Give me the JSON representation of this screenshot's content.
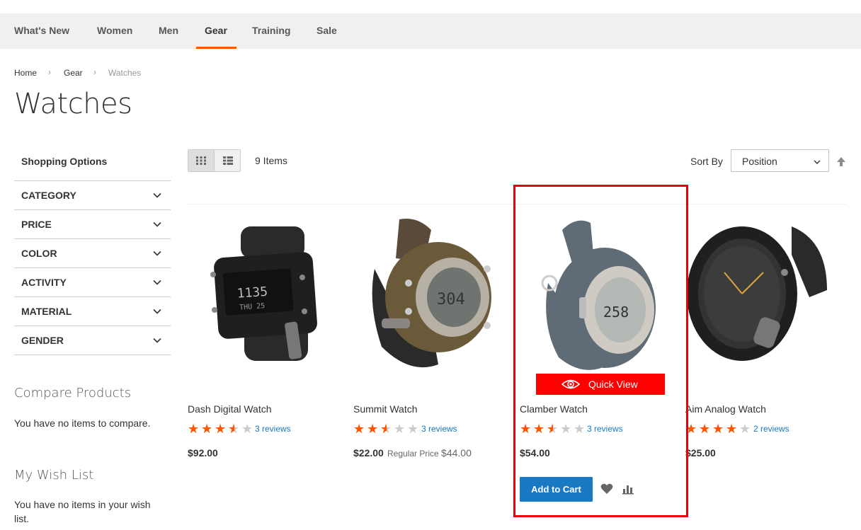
{
  "nav": {
    "items": [
      "What's New",
      "Women",
      "Men",
      "Gear",
      "Training",
      "Sale"
    ],
    "active": "Gear"
  },
  "breadcrumb": [
    "Home",
    "Gear",
    "Watches"
  ],
  "page_title": "Watches",
  "sidebar": {
    "title": "Shopping Options",
    "filters": [
      "CATEGORY",
      "PRICE",
      "COLOR",
      "ACTIVITY",
      "MATERIAL",
      "GENDER"
    ],
    "compare_title": "Compare Products",
    "compare_text": "You have no items to compare.",
    "wishlist_title": "My Wish List",
    "wishlist_text": "You have no items in your wish list."
  },
  "toolbar": {
    "items_count": "9 Items",
    "sort_label": "Sort By",
    "sort_value": "Position"
  },
  "products": [
    {
      "name": "Dash Digital Watch",
      "rating": 3.5,
      "reviews": "3 reviews",
      "price": "$92.00"
    },
    {
      "name": "Summit Watch",
      "rating": 2.5,
      "reviews": "3 reviews",
      "price": "$22.00",
      "regular_label": "Regular Price",
      "regular_price": "$44.00"
    },
    {
      "name": "Clamber Watch",
      "rating": 2.5,
      "reviews": "3 reviews",
      "price": "$54.00"
    },
    {
      "name": "Aim Analog Watch",
      "rating": 4,
      "reviews": "2 reviews",
      "price": "$25.00"
    }
  ],
  "quick_view": "Quick View",
  "add_to_cart": "Add to Cart",
  "colors": {
    "accent": "#ff5501",
    "link": "#1979c3",
    "quickview": "#ff0000",
    "highlight": "#e8000c"
  }
}
